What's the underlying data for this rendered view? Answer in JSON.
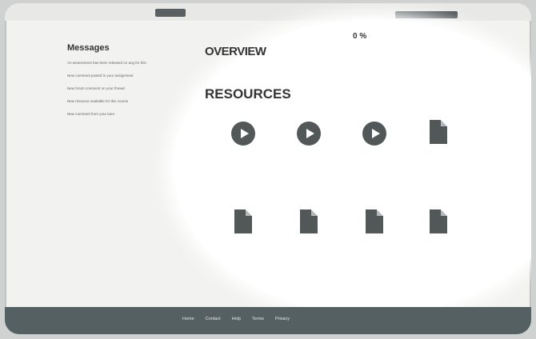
{
  "messages": {
    "title": "Messages",
    "items": [
      {
        "text": "An assessment has been released on ang for this",
        "date": ""
      },
      {
        "text": "New comment posted in your assignment",
        "date": ""
      },
      {
        "text": "New forum comment on your thread",
        "date": ""
      },
      {
        "text": "New resource available for this course",
        "date": ""
      },
      {
        "text": "New comment from your tutor",
        "date": ""
      }
    ]
  },
  "overview": {
    "label": "OVERVIEW"
  },
  "progress": {
    "percent": "0 %"
  },
  "resources": {
    "title": "RESOURCES",
    "items": [
      {
        "type": "video",
        "icon": "play-icon",
        "caption": ""
      },
      {
        "type": "video",
        "icon": "play-icon",
        "caption": ""
      },
      {
        "type": "video",
        "icon": "play-icon",
        "caption": ""
      },
      {
        "type": "document",
        "icon": "document-icon",
        "caption": ""
      },
      {
        "type": "document",
        "icon": "document-icon",
        "caption": ""
      },
      {
        "type": "document",
        "icon": "document-icon",
        "caption": ""
      },
      {
        "type": "document",
        "icon": "document-icon",
        "caption": ""
      },
      {
        "type": "document",
        "icon": "document-icon",
        "caption": ""
      }
    ]
  },
  "footer": {
    "nav": [
      "Home",
      "Contact",
      "Help",
      "Terms",
      "Privacy"
    ]
  },
  "colors": {
    "icon": "#525758",
    "footer": "#556063",
    "accent_text": "#2f6f7a"
  }
}
